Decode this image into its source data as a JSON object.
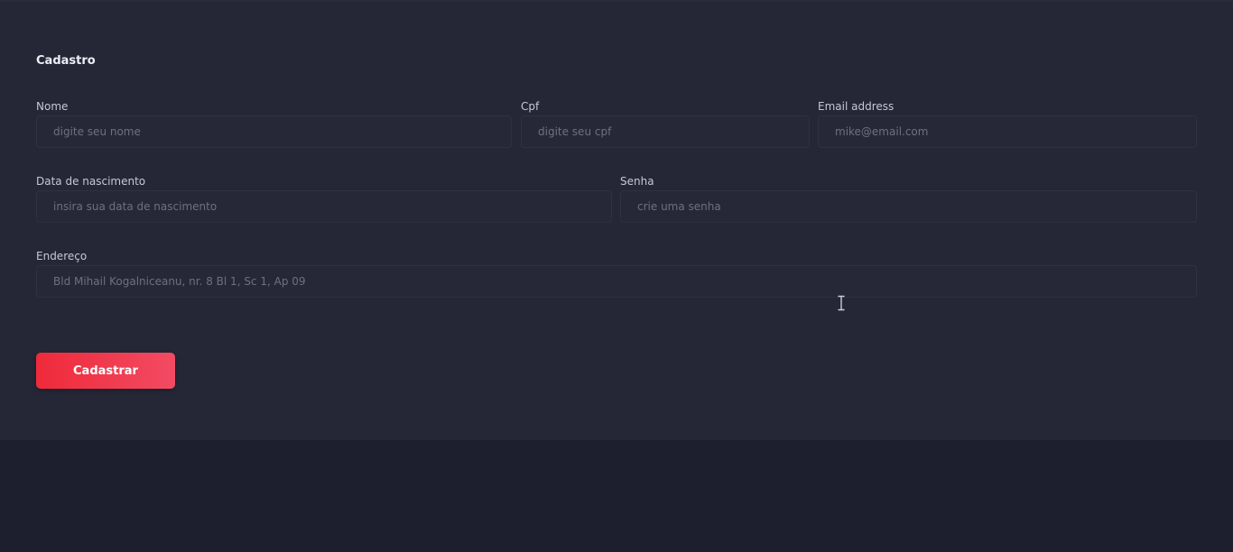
{
  "form": {
    "title": "Cadastro",
    "fields": {
      "nome": {
        "label": "Nome",
        "placeholder": "digite seu nome",
        "value": ""
      },
      "cpf": {
        "label": "Cpf",
        "placeholder": "digite seu cpf",
        "value": ""
      },
      "email": {
        "label": "Email address",
        "placeholder": "mike@email.com",
        "value": ""
      },
      "nascimento": {
        "label": "Data de nascimento",
        "placeholder": "insira sua data de nascimento",
        "value": ""
      },
      "senha": {
        "label": "Senha",
        "placeholder": "crie uma senha",
        "value": ""
      },
      "endereco": {
        "label": "Endereço",
        "placeholder": "Bld Mihail Kogalniceanu, nr. 8 Bl 1, Sc 1, Ap 09",
        "value": ""
      }
    },
    "submit_label": "Cadastrar"
  },
  "colors": {
    "background": "#252736",
    "accent_start": "#ef2a3a",
    "accent_end": "#f24b63"
  },
  "cursor": {
    "icon": "text-cursor-icon"
  }
}
